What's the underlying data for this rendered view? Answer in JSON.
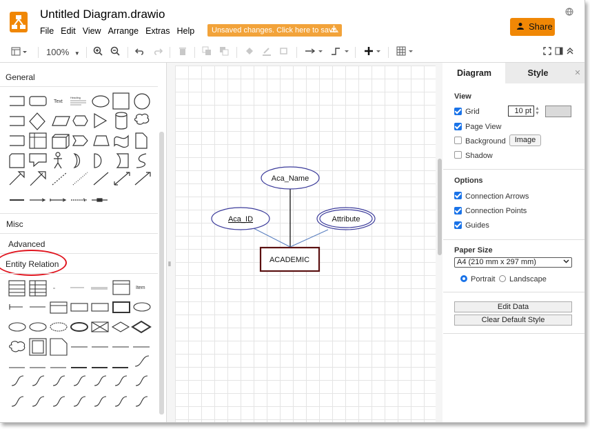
{
  "header": {
    "title": "Untitled Diagram.drawio",
    "menu": [
      "File",
      "Edit",
      "View",
      "Arrange",
      "Extras",
      "Help"
    ],
    "unsaved": "Unsaved changes. Click here to save.",
    "share": "Share"
  },
  "toolbar": {
    "zoom": "100%"
  },
  "sidebar": {
    "general": "General",
    "misc": "Misc",
    "advanced": "Advanced",
    "entity_relation": "Entity Relation",
    "shape_text": "Text",
    "shape_heading": "Heading",
    "er_item": "Item"
  },
  "diagram": {
    "aca_name": "Aca_Name",
    "aca_id": "Aca_ID",
    "attribute": "Attribute",
    "entity": "ACADEMIC"
  },
  "format_panel": {
    "tab_diagram": "Diagram",
    "tab_style": "Style",
    "view_label": "View",
    "grid": "Grid",
    "grid_size": "10 pt",
    "page_view": "Page View",
    "background": "Background",
    "image_button": "Image",
    "shadow": "Shadow",
    "options_label": "Options",
    "connection_arrows": "Connection Arrows",
    "connection_points": "Connection Points",
    "guides": "Guides",
    "paper_size_label": "Paper Size",
    "paper_size": "A4 (210 mm x 297 mm)",
    "portrait": "Portrait",
    "landscape": "Landscape",
    "edit_data": "Edit Data",
    "clear_default_style": "Clear Default Style"
  },
  "colors": {
    "brand": "#f08705",
    "accent": "#1a73e8",
    "ellipse_stroke": "#3a3a9a",
    "entity_stroke": "#5a1010"
  }
}
